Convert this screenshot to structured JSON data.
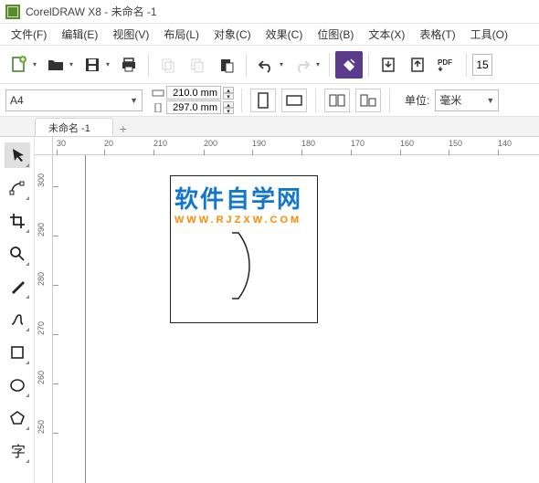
{
  "title": "CorelDRAW X8 - 未命名 -1",
  "menu": [
    "文件(F)",
    "编辑(E)",
    "视图(V)",
    "布局(L)",
    "对象(C)",
    "效果(C)",
    "位图(B)",
    "文本(X)",
    "表格(T)",
    "工具(O)"
  ],
  "toolbar": {
    "new": "新建",
    "open": "打开",
    "save": "保存",
    "print": "打印",
    "cut": "剪切",
    "copy": "复制",
    "paste": "粘贴",
    "undo": "撤销",
    "redo": "重做",
    "search": "搜索",
    "import": "导入",
    "export": "导出",
    "pdf": "PDF",
    "zoom_value": "15"
  },
  "propbar": {
    "page_size": "A4",
    "width": "210.0 mm",
    "height": "297.0 mm",
    "unit_label": "单位:",
    "unit_value": "毫米"
  },
  "tabs": {
    "doc1": "未命名 -1"
  },
  "ruler_h": [
    "30",
    "20",
    "210",
    "200",
    "190",
    "180",
    "170",
    "160",
    "150",
    "140"
  ],
  "ruler_v": [
    "300",
    "290",
    "280",
    "270",
    "260",
    "250"
  ],
  "watermark": {
    "main": "软件自学网",
    "sub": "WWW.RJZXW.COM"
  },
  "tools": [
    "pick",
    "shape",
    "crop",
    "zoom",
    "freehand",
    "bezier",
    "rectangle",
    "ellipse",
    "polygon",
    "text"
  ]
}
